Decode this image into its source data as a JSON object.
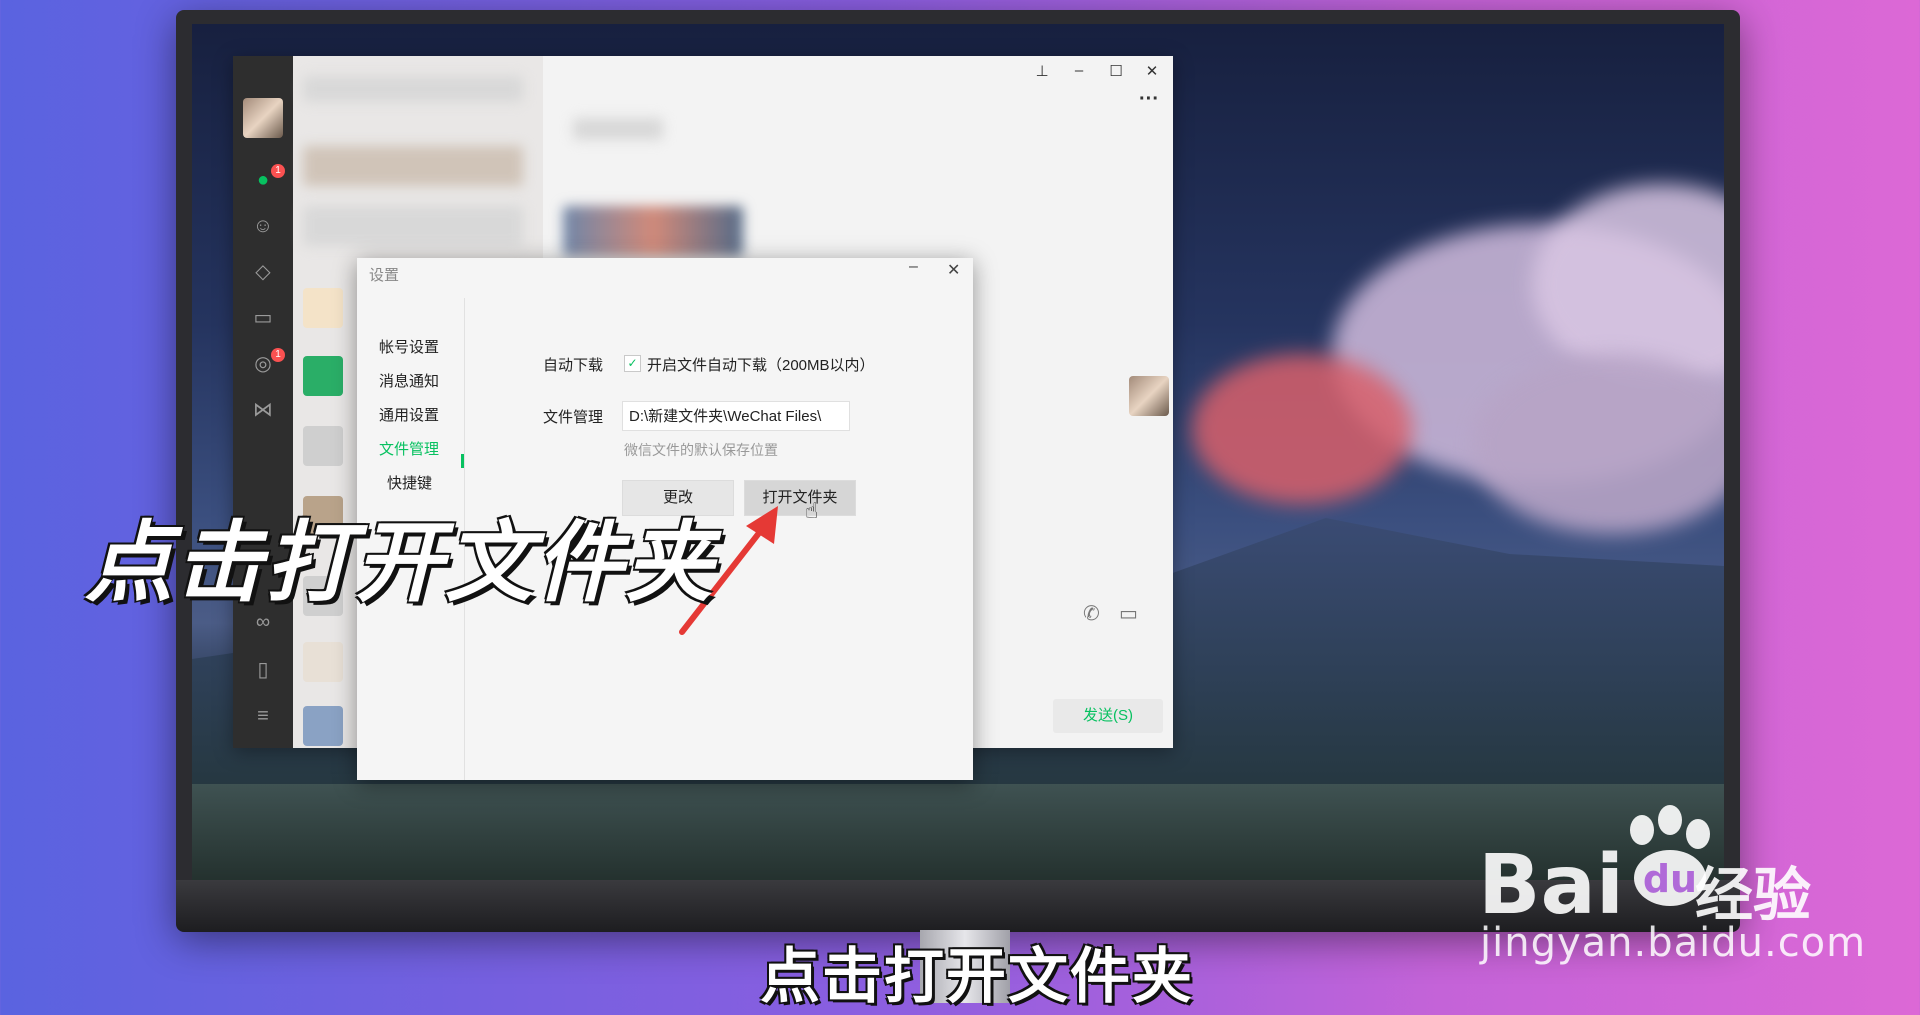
{
  "settings": {
    "title": "设置",
    "minimize": "–",
    "close": "✕",
    "nav": [
      {
        "label": "帐号设置"
      },
      {
        "label": "消息通知"
      },
      {
        "label": "通用设置"
      },
      {
        "label": "文件管理"
      },
      {
        "label": "快捷键"
      }
    ],
    "auto_download_label": "自动下载",
    "auto_download_checkbox": "开启文件自动下载（200MB以内）",
    "file_manage_label": "文件管理",
    "path_value": "D:\\新建文件夹\\WeChat Files\\",
    "path_hint": "微信文件的默认保存位置",
    "change_button": "更改",
    "open_folder_button": "打开文件夹"
  },
  "wechat": {
    "chat_badge": "1",
    "moments_badge": "1",
    "more_menu": "···",
    "send_button": "发送(S)",
    "win_pin": "⊥",
    "win_min": "–",
    "win_max": "☐",
    "win_close": "✕"
  },
  "overlay": {
    "caption": "点击打开文件夹",
    "subtitle": "点击打开文件夹"
  },
  "watermark": {
    "brand_left": "Bai",
    "brand_right": "du",
    "brand_cn": "经验",
    "url": "jingyan.baidu.com"
  },
  "colors": {
    "accent_green": "#07c160",
    "arrow_red": "#e53935"
  }
}
